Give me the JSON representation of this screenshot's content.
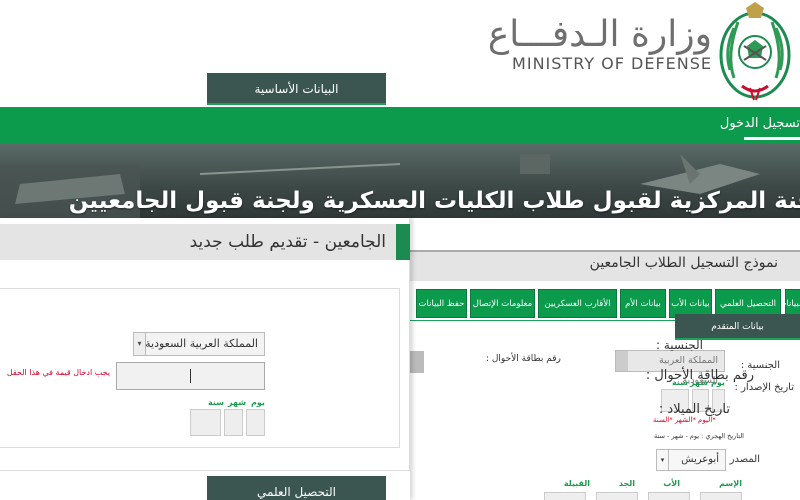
{
  "header": {
    "ministry_ar": "وزارة الـدفـــاع",
    "ministry_en": "MINISTRY OF DEFENSE",
    "emblem_icon": "saudi-mod-emblem"
  },
  "nav": {
    "register_label": "تسجيل الدخول",
    "color": "#0c9a4d"
  },
  "banner": {
    "title": "اللجنة المركزية لقبول طلاب الكليات العسكرية ولجنة قبول الجامعيين"
  },
  "left_form": {
    "title": "الجامعين - تقديم طلب جديد",
    "basic_section": "البيانات الأساسية",
    "education_section": "التحصيل العلمي",
    "nationality_label": "الجنسية :",
    "nationality_value": "المملكة العربية السعودية",
    "card_label": "رقم بطاقة الأحوال :",
    "card_error": "يجب ادخال قيمة في هذا الحقل",
    "dob_label": "تاريخ الميلاد :",
    "dob_year": "سنة",
    "dob_month": "شهر",
    "dob_day": "يوم"
  },
  "right_form": {
    "title": "نموذج التسجيل الطلاب الجامعين",
    "tabs": [
      "البيانات",
      "التحصيل العلمي",
      "بيانات الأب",
      "بيانات الأم",
      "الأقارب العسكريين",
      "معلومات الإتصال",
      "حفظ البيانات"
    ],
    "applicant_section": "بيانات المتقدم",
    "nationality_label": "الجنسية :",
    "nationality_value": "المملكة العربية السعودية",
    "card_label": "رقم بطاقة الأحوال :",
    "issue_label": "تاريخ الإصدار :",
    "issue_year": "سنة",
    "issue_month": "شهر",
    "issue_day": "يوم",
    "issue_hint": "*اليوم *الشهر *السنة",
    "issue_hint2": "التاريخ الهجري : يوم - شهر - سنة",
    "source_label": "المصدر :",
    "source_value": "أبوعريش",
    "name_fields": [
      "الإسم",
      "الأب",
      "الجد",
      "القبيلة"
    ]
  }
}
